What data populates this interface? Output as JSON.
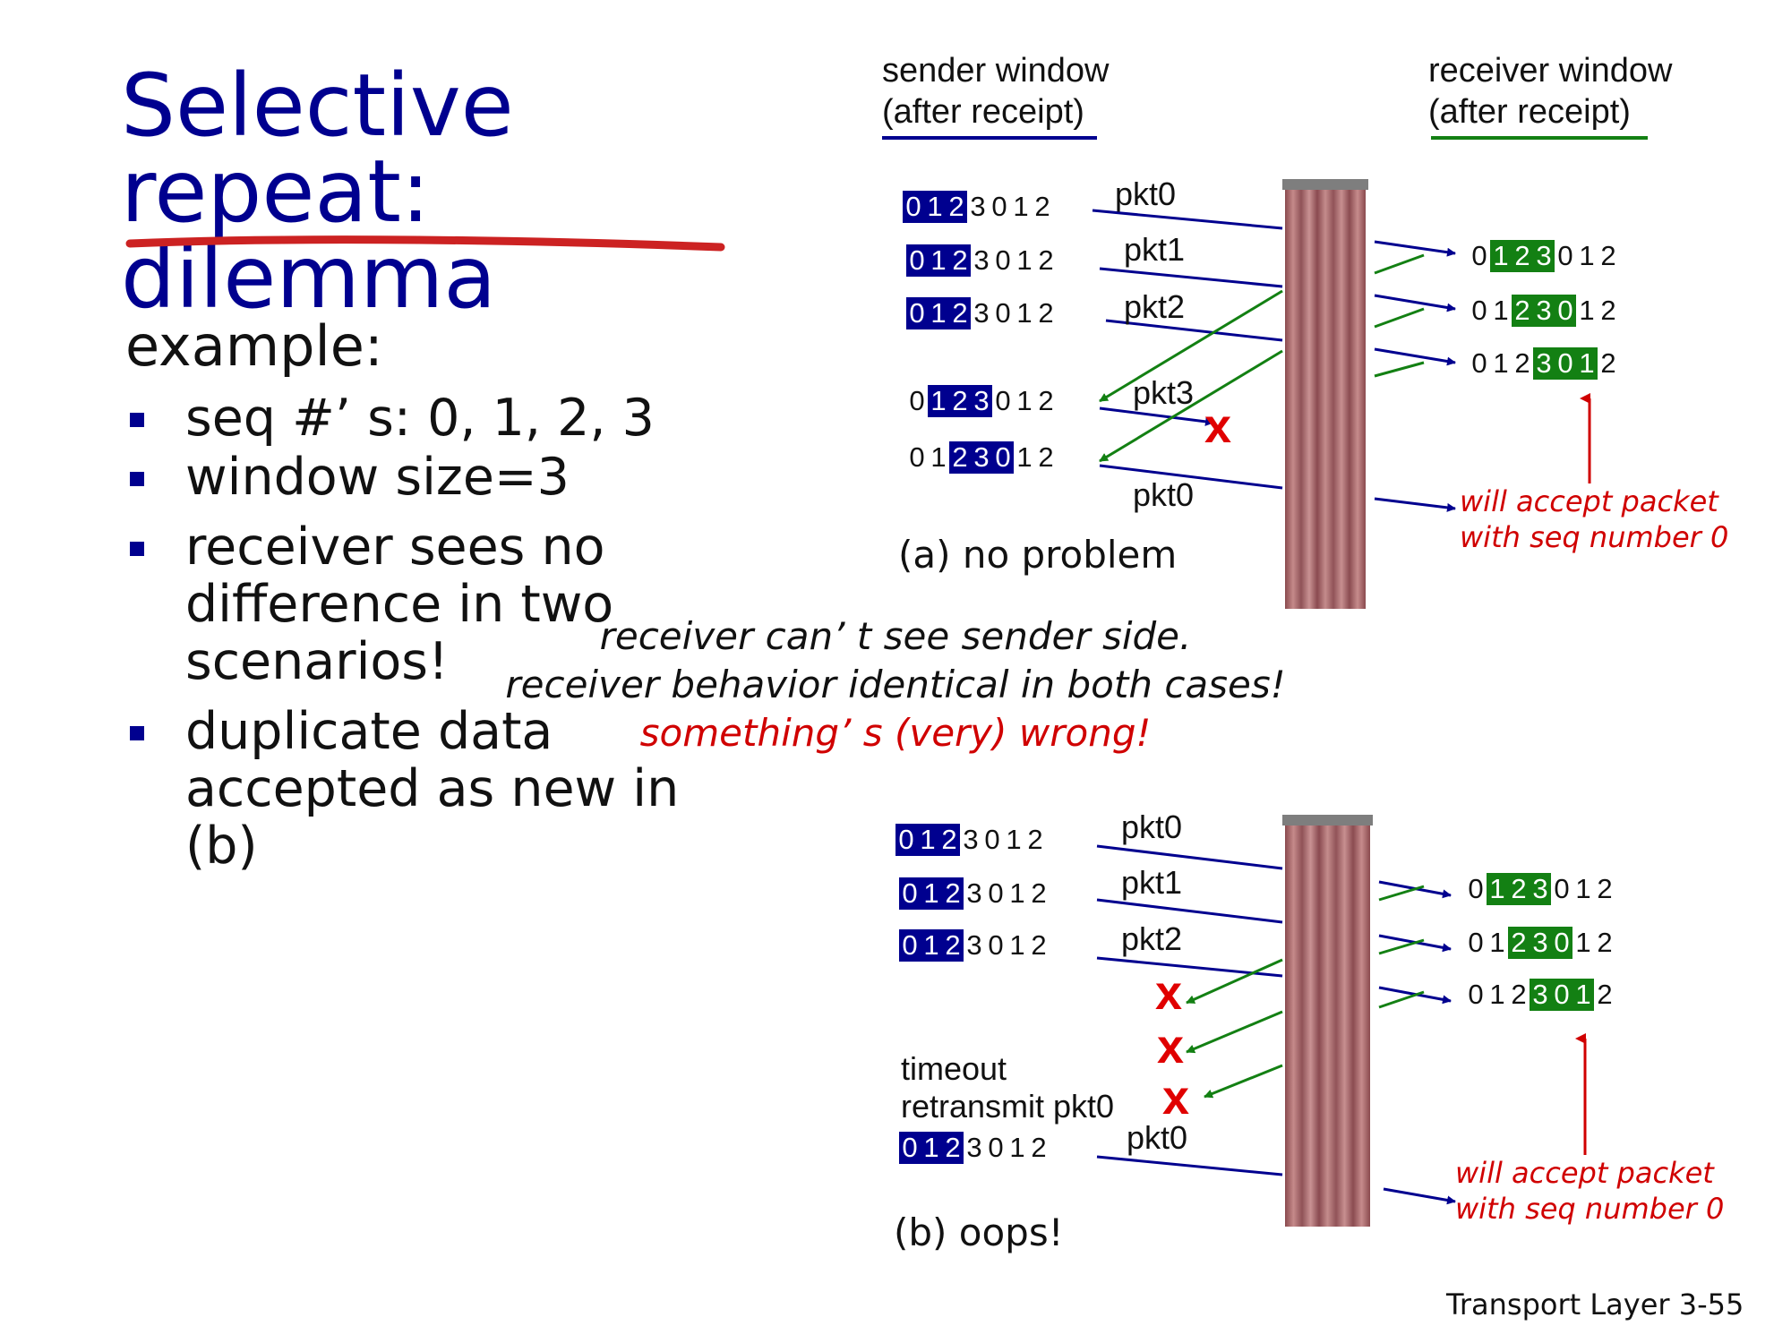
{
  "title": "Selective repeat: dilemma",
  "example_label": "example:",
  "bullets": [
    "seq #’ s: 0, 1, 2, 3",
    "window size=3",
    "receiver sees no difference in two scenarios!",
    "duplicate data accepted as new in (b)"
  ],
  "headers": {
    "sender": [
      "sender window",
      "(after receipt)"
    ],
    "receiver": [
      "receiver window",
      "(after receipt)"
    ]
  },
  "packets": {
    "pkt0": "pkt0",
    "pkt1": "pkt1",
    "pkt2": "pkt2",
    "pkt3": "pkt3"
  },
  "scenario_a": {
    "caption": "(a) no problem",
    "accept": [
      "will accept packet",
      "with seq number 0"
    ]
  },
  "scenario_b": {
    "caption": "(b) oops!",
    "timeout": [
      "timeout",
      "retransmit pkt0"
    ],
    "accept": [
      "will accept packet",
      "with seq number 0"
    ]
  },
  "middle": {
    "line1": "receiver can’ t see sender side.",
    "line2": "receiver behavior identical in both cases!",
    "line3": "something’ s (very) wrong!"
  },
  "xmark": "x",
  "footer": {
    "label": "Transport Layer",
    "page": "3-55"
  },
  "colors": {
    "title": "#00008f",
    "sender_window": "#00008f",
    "receiver_window": "#138013",
    "ack": "#138013",
    "highlight": "#d00000"
  }
}
